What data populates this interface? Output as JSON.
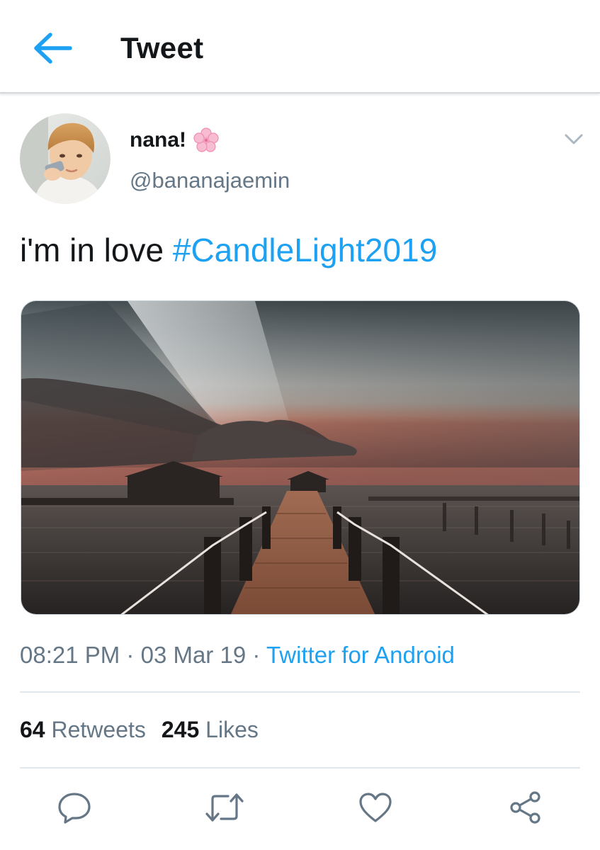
{
  "header": {
    "title": "Tweet",
    "back_icon": "arrow-left-icon",
    "accent": "#1da1f2"
  },
  "tweet": {
    "author": {
      "display_name": "nana!",
      "emoji_icon": "cherry-blossom-icon",
      "handle": "@bananajaemin"
    },
    "text": "i'm in love ",
    "hashtag": "#CandleLight2019",
    "media_icon": "sunset-pier-photo",
    "time": "08:21 PM",
    "separator": "·",
    "date": "03 Mar 19",
    "source": "Twitter for Android",
    "retweets_count": "64",
    "retweets_label": "Retweets",
    "likes_count": "245",
    "likes_label": "Likes"
  },
  "actions": [
    {
      "name": "reply",
      "icon": "reply-icon"
    },
    {
      "name": "retweet",
      "icon": "retweet-icon"
    },
    {
      "name": "like",
      "icon": "heart-icon"
    },
    {
      "name": "share",
      "icon": "share-icon"
    }
  ],
  "colors": {
    "text_primary": "#14171a",
    "text_secondary": "#657786",
    "link": "#1da1f2",
    "divider": "#e1e8ed"
  }
}
